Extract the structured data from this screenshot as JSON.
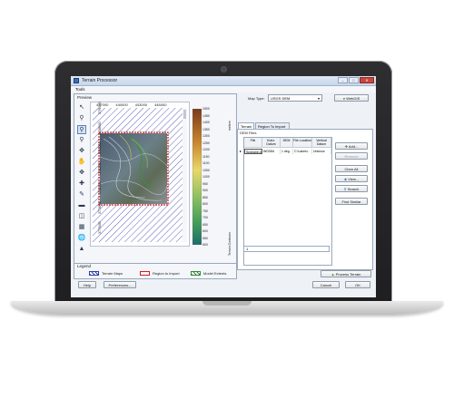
{
  "window": {
    "title": "Terrain Processor"
  },
  "menu": {
    "tools": "Tools"
  },
  "preview": {
    "label": "Preview",
    "x_ticks": [
      "437000",
      "440000",
      "443000",
      "446000"
    ],
    "y_ticks": [
      "3790000",
      "3788000",
      "3785000",
      "3782000",
      "3780000",
      "3778000",
      "3775000"
    ],
    "legend_ticks": [
      "1500",
      "1450",
      "1400",
      "1350",
      "1300",
      "1250",
      "1200",
      "1150",
      "1100",
      "1050",
      "1000",
      "950",
      "900",
      "850",
      "800",
      "750",
      "700",
      "650",
      "600",
      "550",
      "500"
    ],
    "legend_title": "meters",
    "side_label": "Terrain Contours"
  },
  "legend": {
    "label": "Legend",
    "terrain_maps": "Terrain Maps",
    "region_to_import": "Region to Import",
    "model_extents": "Model Extents"
  },
  "controls": {
    "map_type_label": "Map Type:",
    "map_type_value": "USGS DEM",
    "webgis_button": "WebGIS",
    "tabs": [
      "Terrain",
      "Region To Import"
    ],
    "dem_files_label": "DEM Files",
    "columns": [
      "File",
      "Horiz. Datum",
      "DEM",
      "File Location",
      "Vertical Datum"
    ],
    "row": [
      "Spokane-e",
      "WGS84",
      "1 deg.",
      "C:\\Lakesi..",
      "Unknow"
    ],
    "buttons": [
      "Add...",
      "Remove",
      "Clear All",
      "View...",
      "Search",
      "Find Similar"
    ],
    "row_number": "1",
    "process_button": "Process Terrain"
  },
  "footer": {
    "help": "Help",
    "preferences": "Preferences...",
    "cancel": "Cancel",
    "ok": "OK"
  }
}
